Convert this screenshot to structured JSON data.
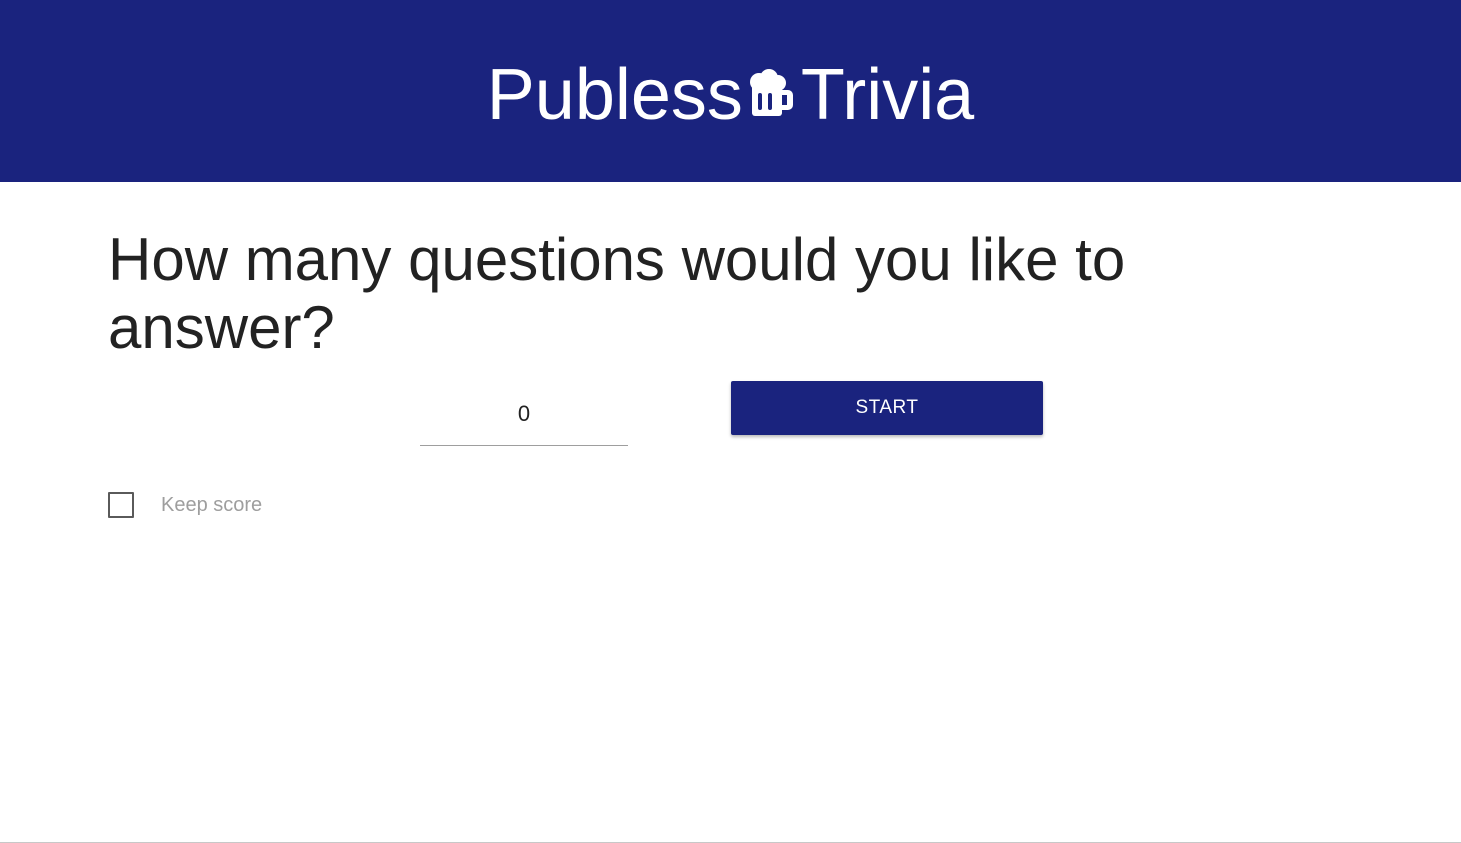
{
  "header": {
    "logo_left": "Publess",
    "logo_icon": "beer-mug-icon",
    "logo_right": "Trivia",
    "background_color": "#1a237e"
  },
  "main": {
    "question": "How many questions would you like to answer?",
    "question_count": {
      "value": "0",
      "placeholder": ""
    },
    "start_label": "START",
    "keep_score": {
      "label": "Keep score",
      "checked": false
    }
  },
  "colors": {
    "primary": "#1a237e",
    "text": "#222222",
    "muted": "#9e9e9e"
  }
}
